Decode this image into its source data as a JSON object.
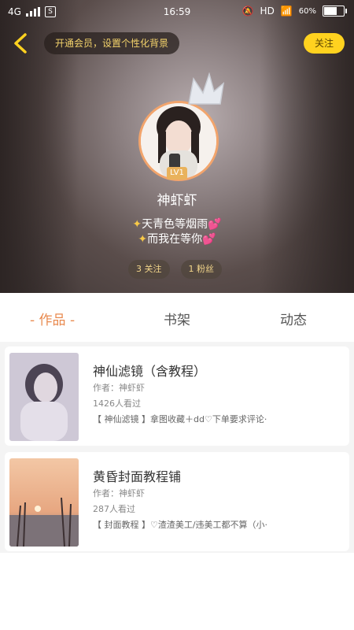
{
  "status_bar": {
    "network": "4G",
    "time": "16:59",
    "hd": "HD",
    "battery": "60%"
  },
  "header": {
    "promo": "开通会员，设置个性化背景",
    "follow": "关注",
    "level": "LV1",
    "username": "神虾虾",
    "bio_line1": "天青色等烟雨",
    "bio_line2": "而我在等你",
    "following": "3 关注",
    "fans": "1 粉丝"
  },
  "tabs": {
    "works": "- 作品 -",
    "shelf": "书架",
    "activity": "动态"
  },
  "cards": [
    {
      "title": "神仙滤镜（含教程）",
      "author": "作者：神虾虾",
      "views": "1426人看过",
      "desc": "【 神仙滤镜 】拿图收藏＋dd♡下单要求评论·"
    },
    {
      "title": "黄昏封面教程铺",
      "author": "作者：神虾虾",
      "views": "287人看过",
      "desc": "【 封面教程 】♡渣渣美工/违美工都不算（小·"
    }
  ],
  "colors": {
    "accent": "#ffd21f",
    "active_tab": "#e98a4f",
    "avatar_ring": "#f2a46c"
  }
}
